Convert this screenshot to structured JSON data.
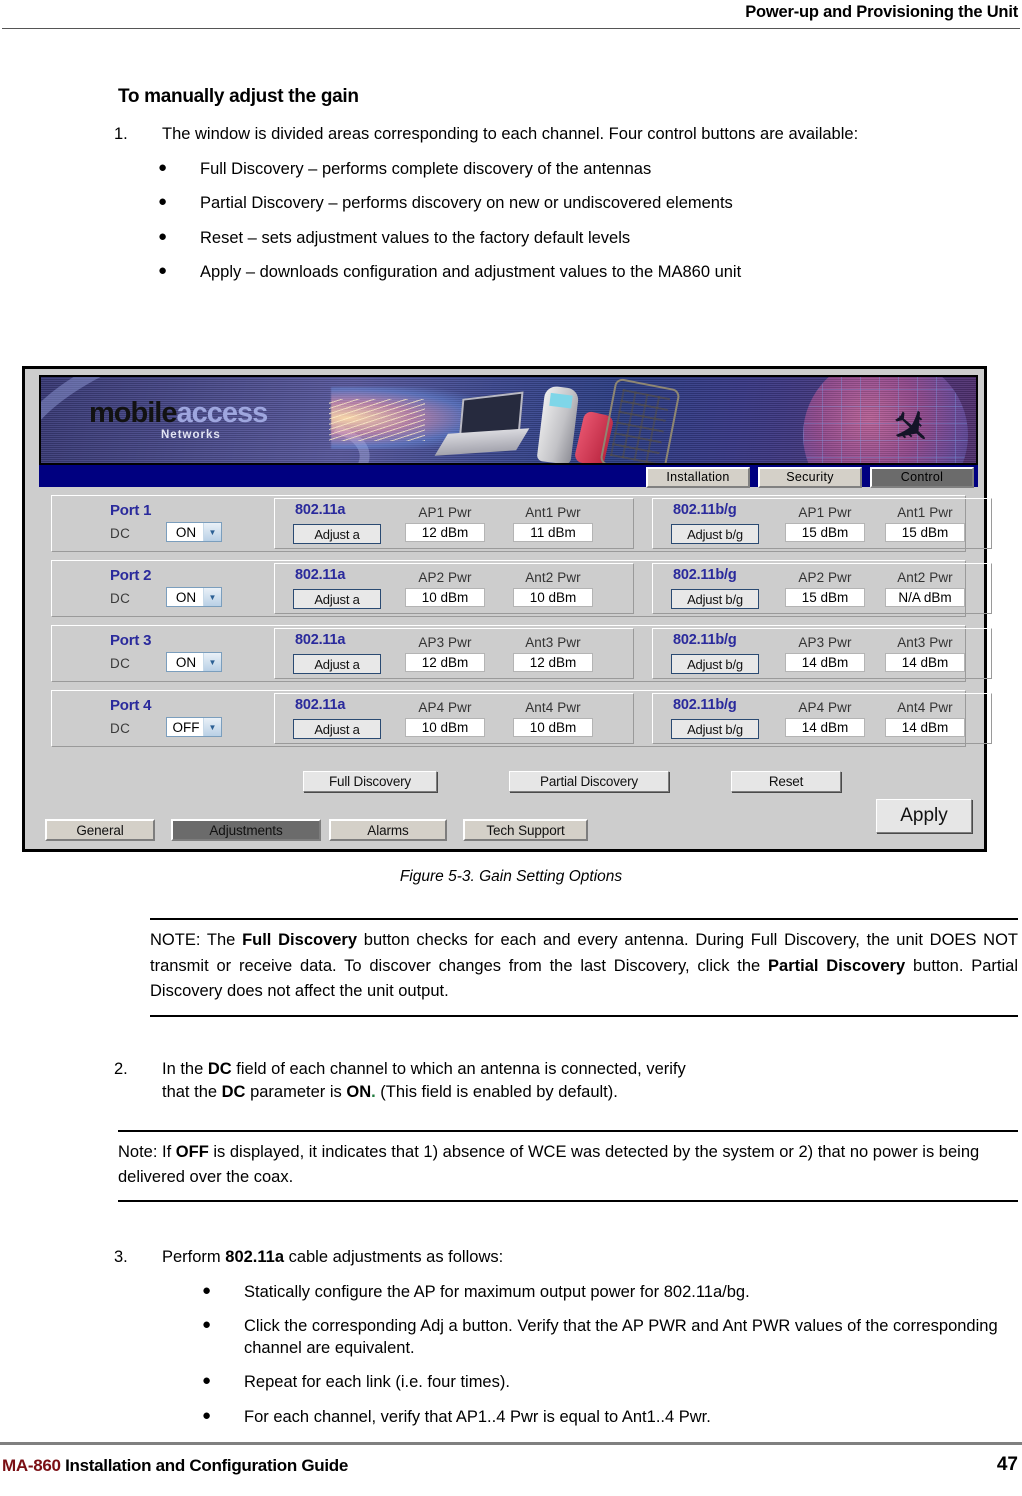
{
  "header": {
    "title": "Power-up and Provisioning the Unit"
  },
  "section": {
    "title": "To manually adjust the gain"
  },
  "step1": {
    "number": "1.",
    "text": "The window is divided areas corresponding to each channel. Four control buttons are available:",
    "bullets": [
      "Full Discovery – performs complete discovery of the antennas",
      "Partial Discovery – performs discovery on new or undiscovered elements",
      "Reset – sets adjustment values to the factory default levels",
      "Apply – downloads configuration and adjustment values to the MA860 unit"
    ]
  },
  "figure": {
    "caption": "Figure 5-3. Gain Setting Options",
    "app": {
      "logo": {
        "word1": "mobile",
        "word2": "access",
        "subtitle": "Networks"
      },
      "nav_tabs": [
        {
          "label": "Installation",
          "active": false
        },
        {
          "label": "Security",
          "active": false
        },
        {
          "label": "Control",
          "active": true
        }
      ],
      "column_headers": {
        "dc": "DC"
      },
      "ports": [
        {
          "port_label": "Port 1",
          "dc_label": "DC",
          "dc_value": "ON",
          "a": {
            "standard": "802.11a",
            "adjust_label": "Adjust a",
            "ap_caption": "AP1 Pwr",
            "ap_value": "12 dBm",
            "ant_caption": "Ant1 Pwr",
            "ant_value": "11 dBm"
          },
          "bg": {
            "standard": "802.11b/g",
            "adjust_label": "Adjust b/g",
            "ap_caption": "AP1 Pwr",
            "ap_value": "15 dBm",
            "ant_caption": "Ant1 Pwr",
            "ant_value": "15 dBm"
          }
        },
        {
          "port_label": "Port 2",
          "dc_label": "DC",
          "dc_value": "ON",
          "a": {
            "standard": "802.11a",
            "adjust_label": "Adjust a",
            "ap_caption": "AP2 Pwr",
            "ap_value": "10 dBm",
            "ant_caption": "Ant2 Pwr",
            "ant_value": "10 dBm"
          },
          "bg": {
            "standard": "802.11b/g",
            "adjust_label": "Adjust b/g",
            "ap_caption": "AP2 Pwr",
            "ap_value": "15 dBm",
            "ant_caption": "Ant2 Pwr",
            "ant_value": "N/A dBm"
          }
        },
        {
          "port_label": "Port 3",
          "dc_label": "DC",
          "dc_value": "ON",
          "a": {
            "standard": "802.11a",
            "adjust_label": "Adjust a",
            "ap_caption": "AP3 Pwr",
            "ap_value": "12 dBm",
            "ant_caption": "Ant3 Pwr",
            "ant_value": "12 dBm"
          },
          "bg": {
            "standard": "802.11b/g",
            "adjust_label": "Adjust b/g",
            "ap_caption": "AP3 Pwr",
            "ap_value": "14 dBm",
            "ant_caption": "Ant3 Pwr",
            "ant_value": "14 dBm"
          }
        },
        {
          "port_label": "Port 4",
          "dc_label": "DC",
          "dc_value": "OFF",
          "a": {
            "standard": "802.11a",
            "adjust_label": "Adjust a",
            "ap_caption": "AP4 Pwr",
            "ap_value": "10 dBm",
            "ant_caption": "Ant4 Pwr",
            "ant_value": "10 dBm"
          },
          "bg": {
            "standard": "802.11b/g",
            "adjust_label": "Adjust b/g",
            "ap_caption": "AP4 Pwr",
            "ap_value": "14 dBm",
            "ant_caption": "Ant4 Pwr",
            "ant_value": "14 dBm"
          }
        }
      ],
      "actions": {
        "full_discovery": "Full Discovery",
        "partial_discovery": "Partial Discovery",
        "reset": "Reset",
        "apply": "Apply"
      },
      "bottom_tabs": [
        {
          "label": "General",
          "active": false
        },
        {
          "label": "Adjustments",
          "active": true
        },
        {
          "label": "Alarms",
          "active": false
        },
        {
          "label": "Tech Support",
          "active": false
        }
      ]
    }
  },
  "note1": {
    "prefix": "NOTE: The ",
    "bold1": "Full Discovery",
    "mid1": " button checks for each and every antenna. During Full Discovery, the unit DOES NOT transmit or receive data. To discover changes from the last Discovery, click the ",
    "bold2": "Partial Discovery",
    "mid2": " button. Partial Discovery does not affect the unit output."
  },
  "step2": {
    "number": "2.",
    "part1": "In the ",
    "bold1": "DC",
    "part2": " field of each channel to which an antenna is connected, verify",
    "part3": "that the ",
    "bold2": "DC",
    "part4": " parameter is ",
    "bold3": "ON",
    "dot": ".",
    "part5": " (This field is enabled by default)."
  },
  "note2": {
    "part1": "Note: If ",
    "bold1": "OFF",
    "part2": " is displayed, it indicates that 1) absence of WCE was detected by the system or 2) that no power is being delivered over the coax."
  },
  "step3": {
    "number": "3.",
    "part1": "Perform ",
    "bold1": "802.11a",
    "part2": " cable adjustments as follows:",
    "bullets": [
      "Statically configure the AP for maximum output power for 802.11a/bg.",
      "Click the corresponding Adj a button. Verify that the AP PWR and Ant PWR values of the corresponding channel are equivalent.",
      "Repeat for each link (i.e. four times).",
      "For each channel, verify that AP1..4 Pwr is equal to Ant1..4 Pwr."
    ]
  },
  "footer": {
    "title_prefix": "MA-860",
    "title_rest": " Installation and Configuration Guide",
    "page_number": "47"
  }
}
